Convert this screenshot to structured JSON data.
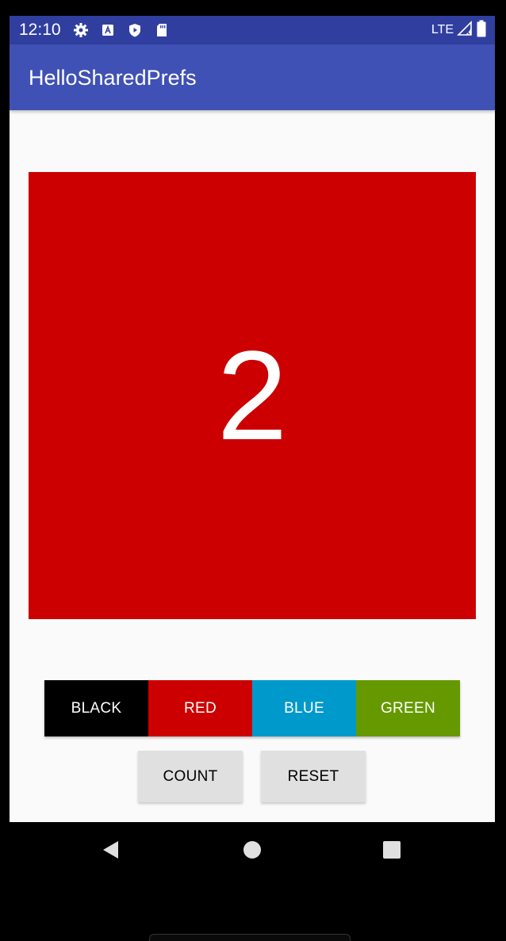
{
  "status_bar": {
    "time": "12:10",
    "network": "LTE",
    "icons_left": [
      "gear-icon",
      "font-a-icon",
      "shield-play-icon",
      "sd-card-icon"
    ],
    "icons_right": [
      "signal-icon",
      "battery-icon"
    ],
    "color": "#303f9f"
  },
  "app_bar": {
    "title": "HelloSharedPrefs",
    "color": "#3f51b5"
  },
  "counter": {
    "value": "2",
    "background_color": "#cc0000"
  },
  "color_buttons": [
    {
      "label": "BLACK",
      "color": "#000000"
    },
    {
      "label": "RED",
      "color": "#cc0000"
    },
    {
      "label": "BLUE",
      "color": "#0099cc"
    },
    {
      "label": "GREEN",
      "color": "#669900"
    }
  ],
  "actions": {
    "count_label": "COUNT",
    "reset_label": "RESET"
  },
  "nav_bar": {
    "icons": [
      "back-icon",
      "home-icon",
      "recents-icon"
    ]
  }
}
